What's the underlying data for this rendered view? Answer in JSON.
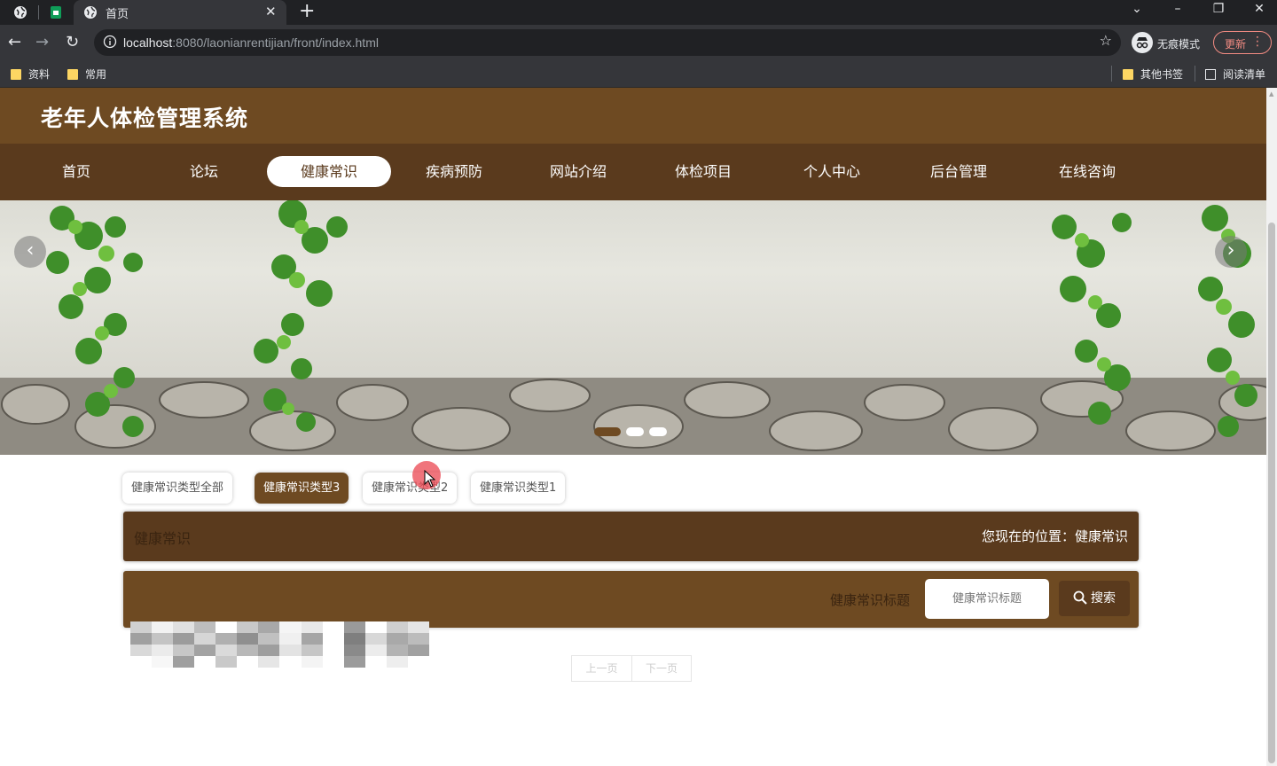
{
  "browser": {
    "tab_title": "首页",
    "tab_close": "✕",
    "new_tab": "+",
    "url_host": "localhost",
    "url_rest": ":8080/laonianrentijian/front/index.html",
    "incognito_label": "无痕模式",
    "update_label": "更新",
    "bookmarks": [
      "资料",
      "常用"
    ],
    "other_bookmarks": "其他书签",
    "reading_list": "阅读清单"
  },
  "site": {
    "title": "老年人体检管理系统"
  },
  "nav": {
    "items": [
      "首页",
      "论坛",
      "健康常识",
      "疾病预防",
      "网站介绍",
      "体检项目",
      "个人中心",
      "后台管理",
      "在线咨询"
    ],
    "active_index": 2
  },
  "carousel": {
    "prev": "‹",
    "next": "›",
    "slide_count": 3,
    "active_slide": 0
  },
  "categories": {
    "items": [
      "健康常识类型全部",
      "健康常识类型3",
      "健康常识类型2",
      "健康常识类型1"
    ],
    "active_index": 1
  },
  "breadcrumb": {
    "title": "健康常识",
    "position": "您现在的位置：健康常识"
  },
  "search": {
    "label": "健康常识标题",
    "placeholder": "健康常识标题",
    "button_label": "搜索"
  },
  "pager": {
    "prev": "上一页",
    "next": "下一页"
  },
  "colors": {
    "header": "#6e4a22",
    "nav": "#5a3a1d",
    "accent": "#6e4a22"
  }
}
